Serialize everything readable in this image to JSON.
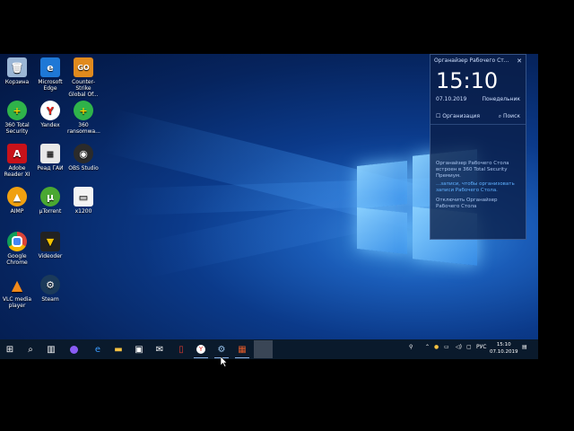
{
  "desktop": {
    "icons": [
      {
        "label": "Корзина",
        "icon": "recycle-bin-icon",
        "color": "#9ab6d6"
      },
      {
        "label": "Microsoft Edge",
        "icon": "edge-icon",
        "color": "#1e78d6"
      },
      {
        "label": "Counter-Strike Global Of...",
        "icon": "csgo-icon",
        "color": "#e08a1e"
      },
      {
        "label": "360 Total Security",
        "icon": "360-icon",
        "color": "#2fb34a"
      },
      {
        "label": "Yandex",
        "icon": "yandex-icon",
        "color": "#ffffff"
      },
      {
        "label": "360 ransomwa...",
        "icon": "360-ransom-icon",
        "color": "#2fb34a"
      },
      {
        "label": "Adobe Reader XI",
        "icon": "adobe-reader-icon",
        "color": "#c8121a"
      },
      {
        "label": "Реад ГАИ",
        "icon": "document-icon",
        "color": "#e8e8e8"
      },
      {
        "label": "OBS Studio",
        "icon": "obs-icon",
        "color": "#2b2b2b"
      },
      {
        "label": "AIMP",
        "icon": "aimp-icon",
        "color": "#f0a010"
      },
      {
        "label": "μTorrent",
        "icon": "utorrent-icon",
        "color": "#4aa832"
      },
      {
        "label": "x1200",
        "icon": "file-icon",
        "color": "#f4f4f4"
      },
      {
        "label": "Google Chrome",
        "icon": "chrome-icon",
        "color": "#ffffff"
      },
      {
        "label": "Videoder",
        "icon": "videoder-icon",
        "color": "#222222"
      },
      {
        "label": "VLC media player",
        "icon": "vlc-icon",
        "color": "#f28a1a"
      },
      {
        "label": "Steam",
        "icon": "steam-icon",
        "color": "#1b3a5a"
      }
    ]
  },
  "widget": {
    "title": "Органайзер Рабочего Ст...",
    "time": "15:10",
    "date": "07.10.2019",
    "weekday": "Понедельник",
    "organize_label": "Организация",
    "search_label": "Поиск",
    "info_text": "Органайзер Рабочего Стола встроен в 360 Total Security Премиум.",
    "info_text2": "...записи, чтобы организовать записи Рабочего Стола.",
    "disable_label": "Отключить Органайзер Рабочего Стола"
  },
  "taskbar": {
    "language": "РУС",
    "clock_time": "15:10",
    "clock_date": "07.10.2019",
    "apps": [
      "start-icon",
      "search-icon",
      "task-view-icon",
      "cortana-icon",
      "edge-icon",
      "explorer-icon",
      "store-icon",
      "mail-icon",
      "pdf-icon",
      "yandex-icon",
      "steam-icon",
      "app-icon"
    ]
  },
  "colors": {
    "taskbar_bg": "#0a1a2c",
    "widget_bg": "#0a1e46",
    "accent": "#3a8fe0"
  }
}
